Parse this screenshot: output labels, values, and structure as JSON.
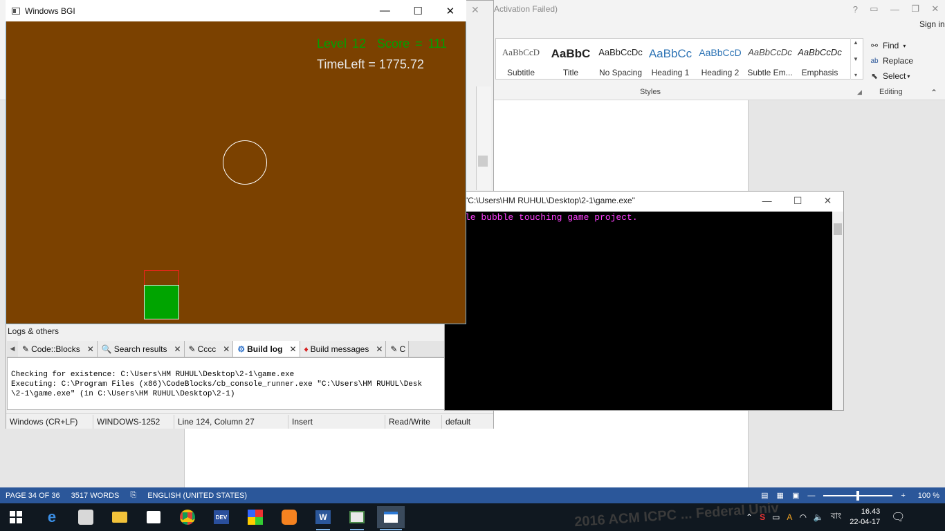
{
  "word": {
    "title_fragment": "Activation Failed)",
    "signin": "Sign in",
    "styles": [
      {
        "sample": "AaBbCcD",
        "label": "Subtitle",
        "color": "#555555"
      },
      {
        "sample": "AaBbC",
        "label": "Title",
        "color": "#222222"
      },
      {
        "sample": "AaBbCcDc",
        "label": "No Spacing",
        "color": "#222222"
      },
      {
        "sample": "AaBbCc",
        "label": "Heading 1",
        "color": "#2e74b5"
      },
      {
        "sample": "AaBbCcD",
        "label": "Heading 2",
        "color": "#2e74b5"
      },
      {
        "sample": "AaBbCcDc",
        "label": "Subtle Em...",
        "color": "#444444"
      },
      {
        "sample": "AaBbCcDc",
        "label": "Emphasis",
        "color": "#222222"
      }
    ],
    "styles_group": "Styles",
    "editing": {
      "find": "Find",
      "replace": "Replace",
      "select": "Select",
      "group": "Editing"
    },
    "status": {
      "page": "PAGE 34 OF 36",
      "words": "3517 WORDS",
      "language": "ENGLISH (UNITED STATES)",
      "zoom": "100 %",
      "zoom_level_percent": 100
    }
  },
  "codeblocks": {
    "logs_title": "Logs & others",
    "tabs": [
      {
        "label": "Code::Blocks",
        "active": false
      },
      {
        "label": "Search results",
        "active": false
      },
      {
        "label": "Cccc",
        "active": false
      },
      {
        "label": "Build log",
        "active": true
      },
      {
        "label": "Build messages",
        "active": false
      },
      {
        "label": "C",
        "active": false
      }
    ],
    "log_lines": [
      "Checking for existence: C:\\Users\\HM RUHUL\\Desktop\\2-1\\game.exe",
      "Executing: C:\\Program Files (x86)\\CodeBlocks/cb_console_runner.exe \"C:\\Users\\HM RUHUL\\Desk",
      "\\2-1\\game.exe\" (in C:\\Users\\HM RUHUL\\Desktop\\2-1)"
    ],
    "status": {
      "eol": "Windows (CR+LF)",
      "encoding": "WINDOWS-1252",
      "position": "Line 124, Column 27",
      "mode": "Insert",
      "access": "Read/Write",
      "lang": "default"
    }
  },
  "console": {
    "title": "\"C:\\Users\\HM RUHUL\\Desktop\\2-1\\game.exe\"",
    "output": "le bubble touching game project."
  },
  "bgi": {
    "title": "Windows BGI",
    "level_text": "Level 12  Score = 111",
    "time_text": "TimeLeft = 1775.72",
    "colors": {
      "background": "#7b4100",
      "score": "#00a000",
      "paddle": "#00a400",
      "paddle_outline": "#ff2020"
    }
  },
  "taskbar": {
    "background_text": "2016 ACM ICPC ... Federal Univ",
    "icons": [
      "windows-start-icon",
      "edge-icon",
      "app-icon",
      "file-explorer-icon",
      "store-icon",
      "chrome-icon",
      "devcpp-icon",
      "codeblocks-icon",
      "uc-browser-icon",
      "word-icon",
      "app-window-icon",
      "active-app-icon"
    ],
    "tray": {
      "language": "বাং",
      "time": "16.43",
      "date": "22-04-17"
    }
  }
}
